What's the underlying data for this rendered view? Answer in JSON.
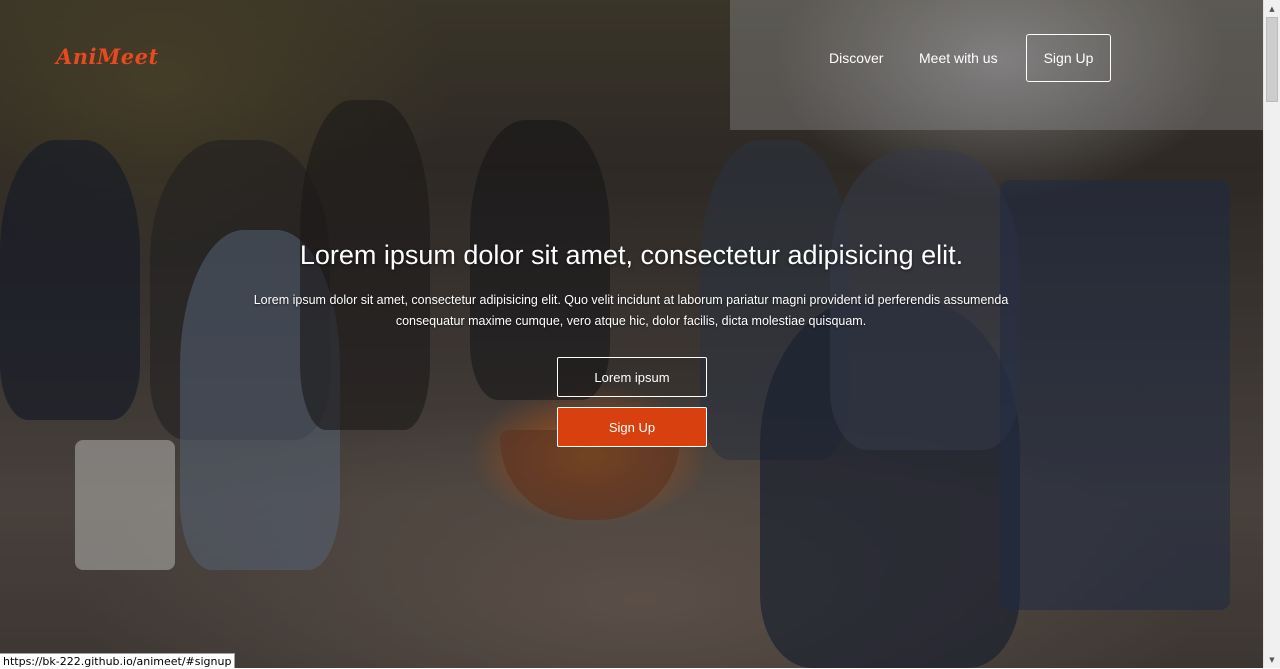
{
  "brand": {
    "logo_text": "AniMeet",
    "logo_color": "#e8491d"
  },
  "nav": {
    "links": [
      {
        "label": "Discover"
      },
      {
        "label": "Meet with us"
      }
    ],
    "signup_label": "Sign Up"
  },
  "hero": {
    "title": "Lorem ipsum dolor sit amet, consectetur adipisicing elit.",
    "text": "Lorem ipsum dolor sit amet, consectetur adipisicing elit. Quo velit incidunt at laborum pariatur magni provident id perferendis assumenda consequatur maxime cumque, vero atque hic, dolor facilis, dicta molestiae quisquam.",
    "primary_button_label": "Lorem ipsum",
    "signup_button_label": "Sign Up"
  },
  "colors": {
    "accent": "#d9400f",
    "text": "#ffffff"
  },
  "status_bar": {
    "url": "https://bk-222.github.io/animeet/#signup"
  },
  "scrollbar": {
    "up_icon": "arrow-up-icon",
    "down_icon": "arrow-down-icon"
  }
}
